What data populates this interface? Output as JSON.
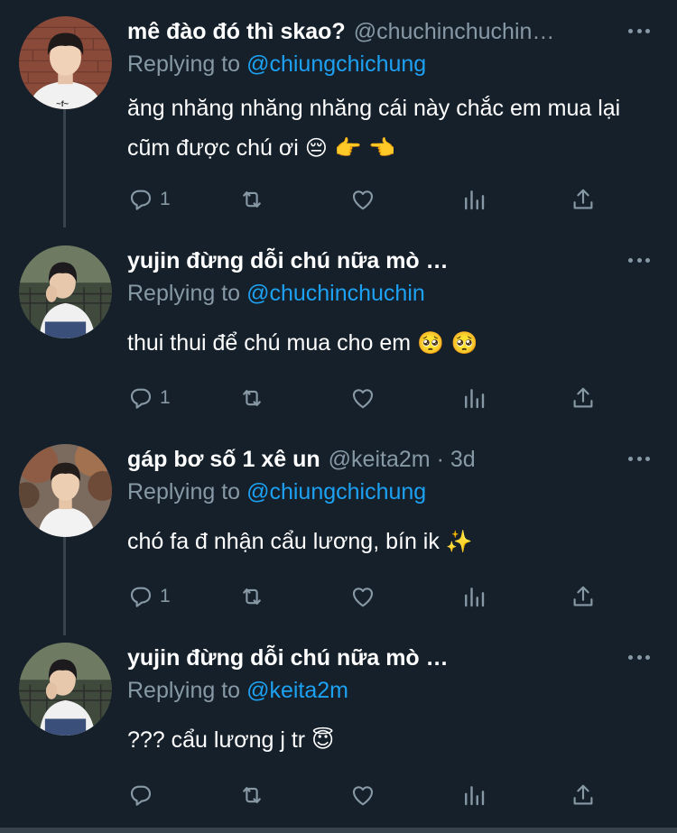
{
  "tweets": [
    {
      "name": "mê đào đó thì skao?",
      "handle": "@chuchinchuchin…",
      "time": "",
      "replying_prefix": "Replying to",
      "replying_to": "@chiungchichung",
      "body": "ăng nhăng nhăng nhăng cái này chắc em mua lại cũm được chú ơi",
      "body_emoji": "😔 👉 👈",
      "reply_count": "1",
      "avatar": "boy-white-shirt-brick-wall"
    },
    {
      "name": "yujin đừng dỗi chú nữa mò …",
      "handle": "",
      "time": "",
      "replying_prefix": "Replying to",
      "replying_to": "@chuchinchuchin",
      "body": "thui thui để chú mua cho em",
      "body_emoji": "🥺 🥺",
      "reply_count": "1",
      "avatar": "boy-sitting-fence"
    },
    {
      "name": "gáp bơ số 1 xê un",
      "handle": "@keita2m",
      "time": "3d",
      "replying_prefix": "Replying to",
      "replying_to": "@chiungchichung",
      "body": "chó fa đ nhận cẩu lương, bín ik",
      "body_emoji": "✨",
      "reply_count": "1",
      "avatar": "boy-autumn-trees"
    },
    {
      "name": "yujin đừng dỗi chú nữa mò …",
      "handle": "",
      "time": "",
      "replying_prefix": "Replying to",
      "replying_to": "@keita2m",
      "body": "??? cẩu lương j tr",
      "body_emoji": "😇",
      "reply_count": "",
      "avatar": "boy-sitting-fence"
    }
  ],
  "icons": {
    "reply": "reply-icon",
    "retweet": "retweet-icon",
    "like": "heart-icon",
    "analytics": "analytics-icon",
    "share": "share-icon",
    "more": "more-icon"
  },
  "colors": {
    "background": "#15202b",
    "text": "#ffffff",
    "secondary": "#8899a6",
    "link": "#1da1f2",
    "divider": "#38444d"
  }
}
